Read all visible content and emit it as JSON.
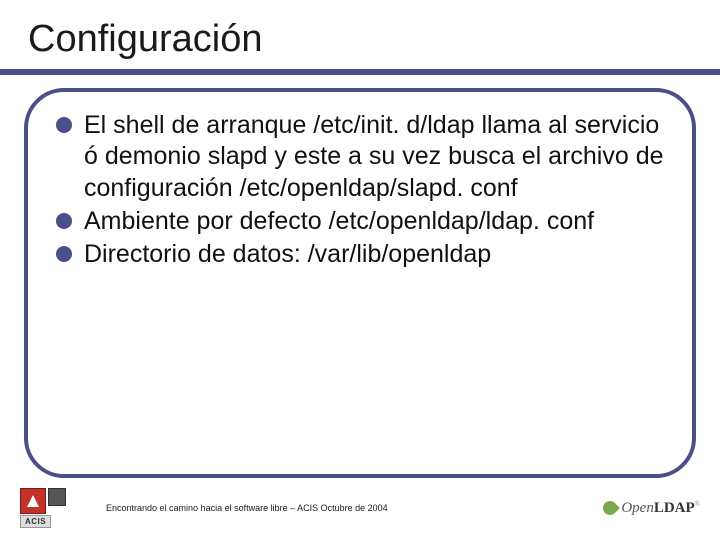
{
  "title": "Configuración",
  "bullets": [
    "El shell de arranque /etc/init. d/ldap llama al servicio ó demonio slapd y este a su vez busca el archivo de configuración /etc/openldap/slapd. conf",
    "Ambiente por defecto /etc/openldap/ldap. conf",
    "Directorio de datos: /var/lib/openldap"
  ],
  "footer": {
    "text": "Encontrando el camino hacia el software libre – ACIS Octubre de 2004",
    "acis_label": "ACIS",
    "ldap_open": "Open",
    "ldap_ldap": "LDAP"
  }
}
